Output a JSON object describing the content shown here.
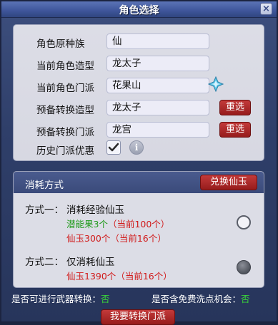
{
  "window": {
    "title": "角色选择",
    "close_label": "×"
  },
  "info_rows": [
    {
      "label": "角色原种族",
      "value": "仙"
    },
    {
      "label": "当前角色造型",
      "value": "龙太子"
    },
    {
      "label": "当前角色门派",
      "value": "花果山"
    },
    {
      "label": "预备转换造型",
      "value": "龙太子",
      "button": "重选"
    },
    {
      "label": "预备转换门派",
      "value": "龙宫",
      "button": "重选"
    }
  ],
  "history": {
    "label": "历史门派优惠",
    "checked": true,
    "info_icon": "i"
  },
  "consume": {
    "title": "消耗方式",
    "exchange_button": "兑换仙玉",
    "option1": {
      "prefix": "方式一：",
      "desc": "消耗经验仙玉",
      "line1_item": "潜能果3个",
      "line1_current": "（当前100个）",
      "line2_item": "仙玉300个",
      "line2_current": "（当前16个）"
    },
    "option2": {
      "prefix": "方式二：",
      "desc": "仅消耗仙玉",
      "line1_item": "仙玉1390个",
      "line1_current": "（当前16个）"
    }
  },
  "footer": {
    "weapon_label": "是否可进行武器转换：",
    "weapon_value": "否",
    "wash_label": "是否含免费洗点机会：",
    "wash_value": "否",
    "transform_button": "我要转换门派"
  },
  "colors": {
    "accent_red": "#b32a2a",
    "green": "#1f9a1a",
    "red": "#d11a1a"
  }
}
